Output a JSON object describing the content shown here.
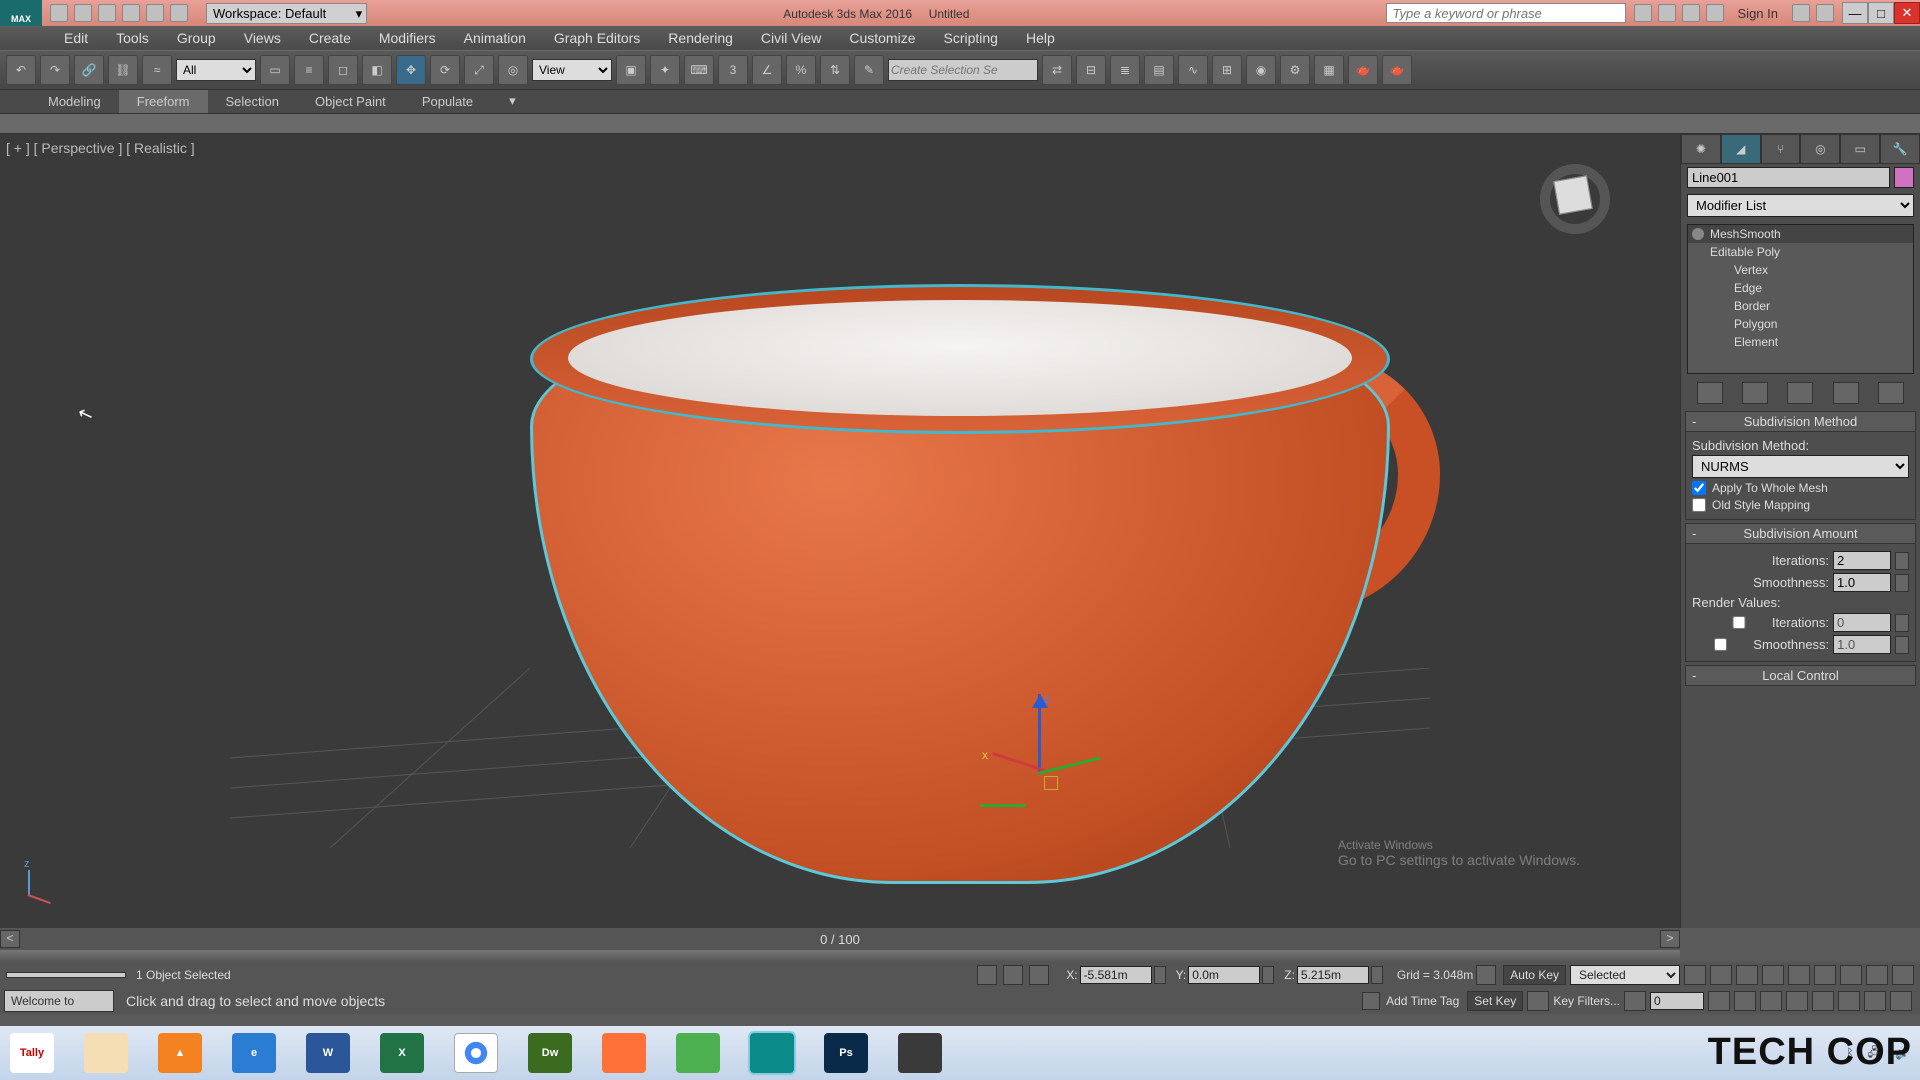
{
  "title": {
    "app": "Autodesk 3ds Max 2016",
    "doc": "Untitled",
    "logo": "MAX"
  },
  "workspace": {
    "label": "Workspace: Default"
  },
  "search": {
    "placeholder": "Type a keyword or phrase"
  },
  "signin": "Sign In",
  "menus": [
    "Edit",
    "Tools",
    "Group",
    "Views",
    "Create",
    "Modifiers",
    "Animation",
    "Graph Editors",
    "Rendering",
    "Civil View",
    "Customize",
    "Scripting",
    "Help"
  ],
  "toolbar": {
    "filter": "All",
    "refcoord": "View",
    "selset_placeholder": "Create Selection Se"
  },
  "ribbon": {
    "tabs": [
      "Modeling",
      "Freeform",
      "Selection",
      "Object Paint",
      "Populate"
    ],
    "active": 1
  },
  "viewport": {
    "label": "[ + ] [ Perspective ] [ Realistic ]"
  },
  "activate": {
    "title": "Activate Windows",
    "sub": "Go to PC settings to activate Windows."
  },
  "cmd": {
    "objname": "Line001",
    "modlist": "Modifier List",
    "stack": {
      "top": "MeshSmooth",
      "base": "Editable Poly",
      "subs": [
        "Vertex",
        "Edge",
        "Border",
        "Polygon",
        "Element"
      ]
    },
    "roll1": {
      "title": "Subdivision Method",
      "label": "Subdivision Method:",
      "value": "NURMS",
      "chk1": "Apply To Whole Mesh",
      "chk2": "Old Style Mapping"
    },
    "roll2": {
      "title": "Subdivision Amount",
      "iter_lbl": "Iterations:",
      "iter": "2",
      "smooth_lbl": "Smoothness:",
      "smooth": "1.0",
      "render_lbl": "Render Values:",
      "riter_lbl": "Iterations:",
      "riter": "0",
      "rsmooth_lbl": "Smoothness:",
      "rsmooth": "1.0"
    },
    "roll3": {
      "title": "Local Control"
    }
  },
  "timeslider": {
    "pos": "0 / 100"
  },
  "status": {
    "objsel": "1 Object Selected",
    "x_lbl": "X:",
    "x": "-5.581m",
    "y_lbl": "Y:",
    "y": "0.0m",
    "z_lbl": "Z:",
    "z": "5.215m",
    "grid": "Grid = 3.048m",
    "autokey": "Auto Key",
    "sel_dd": "Selected"
  },
  "prompt": {
    "welcome": "Welcome to",
    "msg": "Click and drag to select and move objects",
    "addtag": "Add Time Tag",
    "setkey": "Set Key",
    "keyfilters": "Key Filters...",
    "frame": "0"
  },
  "taskbar": {
    "apps": [
      {
        "name": "tally",
        "label": "Tally",
        "bg": "#fff",
        "fg": "#c00"
      },
      {
        "name": "explorer",
        "label": "",
        "bg": "#f5deb3"
      },
      {
        "name": "vlc",
        "label": "▲",
        "bg": "#f58220"
      },
      {
        "name": "ie",
        "label": "e",
        "bg": "#2b7cd3"
      },
      {
        "name": "word",
        "label": "W",
        "bg": "#2b579a"
      },
      {
        "name": "excel",
        "label": "X",
        "bg": "#217346"
      },
      {
        "name": "chrome",
        "label": "",
        "bg": "#fff"
      },
      {
        "name": "dreamweaver",
        "label": "Dw",
        "bg": "#3b6b1f"
      },
      {
        "name": "firefox",
        "label": "",
        "bg": "#ff7139"
      },
      {
        "name": "corel",
        "label": "",
        "bg": "#4caf50"
      },
      {
        "name": "3dsmax",
        "label": "",
        "bg": "#0b8a8a"
      },
      {
        "name": "photoshop",
        "label": "Ps",
        "bg": "#0a2a4a"
      },
      {
        "name": "app",
        "label": "",
        "bg": "#3a3a3a"
      }
    ]
  },
  "watermark": "TECH COP"
}
